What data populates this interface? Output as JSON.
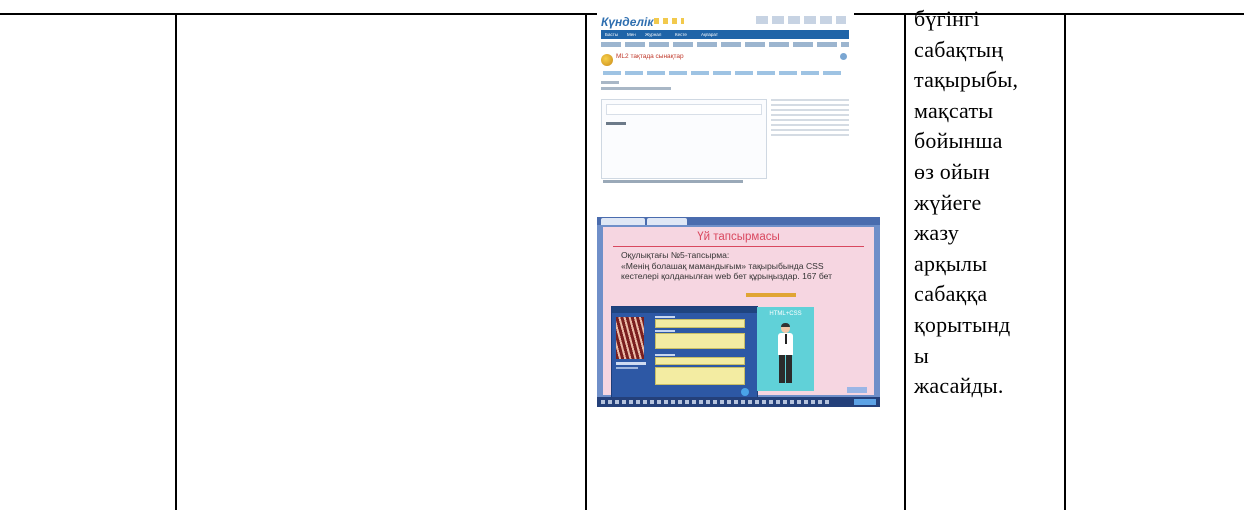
{
  "right_cell": {
    "lines": [
      "бүгінгі",
      "сабақтың",
      "тақырыбы,",
      "мақсаты",
      "бойынша",
      "өз ойын",
      "жүйеге",
      "жазу",
      "арқылы",
      "сабаққа",
      "қорытынд",
      "ы",
      "жасайды."
    ]
  },
  "screenshot_1": {
    "logo": "Күнделік",
    "title": "ML2 тақтада сынақтар",
    "nav": [
      "Басты",
      "Мен",
      "Журнал",
      "Кесте",
      "Ақпарат"
    ]
  },
  "screenshot_2": {
    "title": "Үй тапсырмасы",
    "body_lines": [
      "Оқулықтағы №5-тапсырма:",
      "«Менің болашақ мамандығым» тақырыбында CSS",
      "кестелері қолданылған web бет құрыңыздар. 167 бет"
    ],
    "figure_label": "HTML+CSS"
  }
}
